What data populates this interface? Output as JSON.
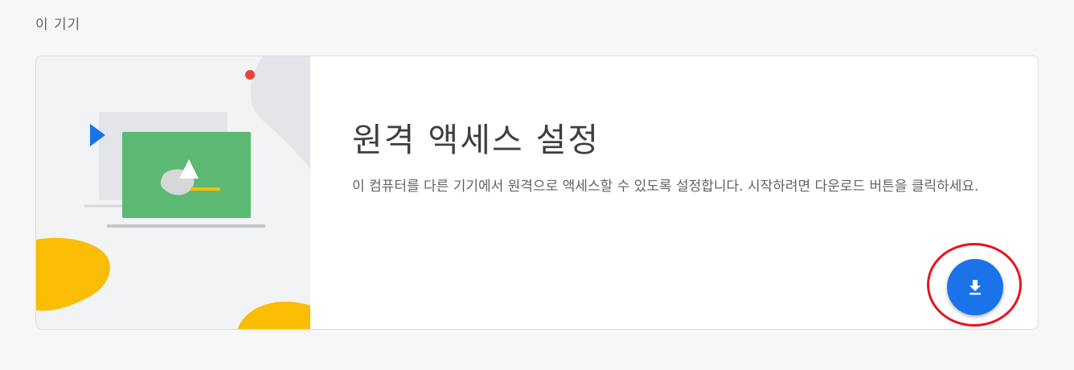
{
  "section": {
    "title": "이 기기"
  },
  "card": {
    "heading": "원격 액세스 설정",
    "description": "이 컴퓨터를 다른 기기에서 원격으로 액세스할 수 있도록 설정합니다. 시작하려면 다운로드 버튼을 클릭하세요."
  },
  "download_button": {
    "icon": "download-icon"
  },
  "colors": {
    "accent": "#1a73e8",
    "screen_green": "#5bb974",
    "blob_yellow": "#fbbc04",
    "dot_red": "#ea4335",
    "annotation_red": "#e8131c"
  }
}
